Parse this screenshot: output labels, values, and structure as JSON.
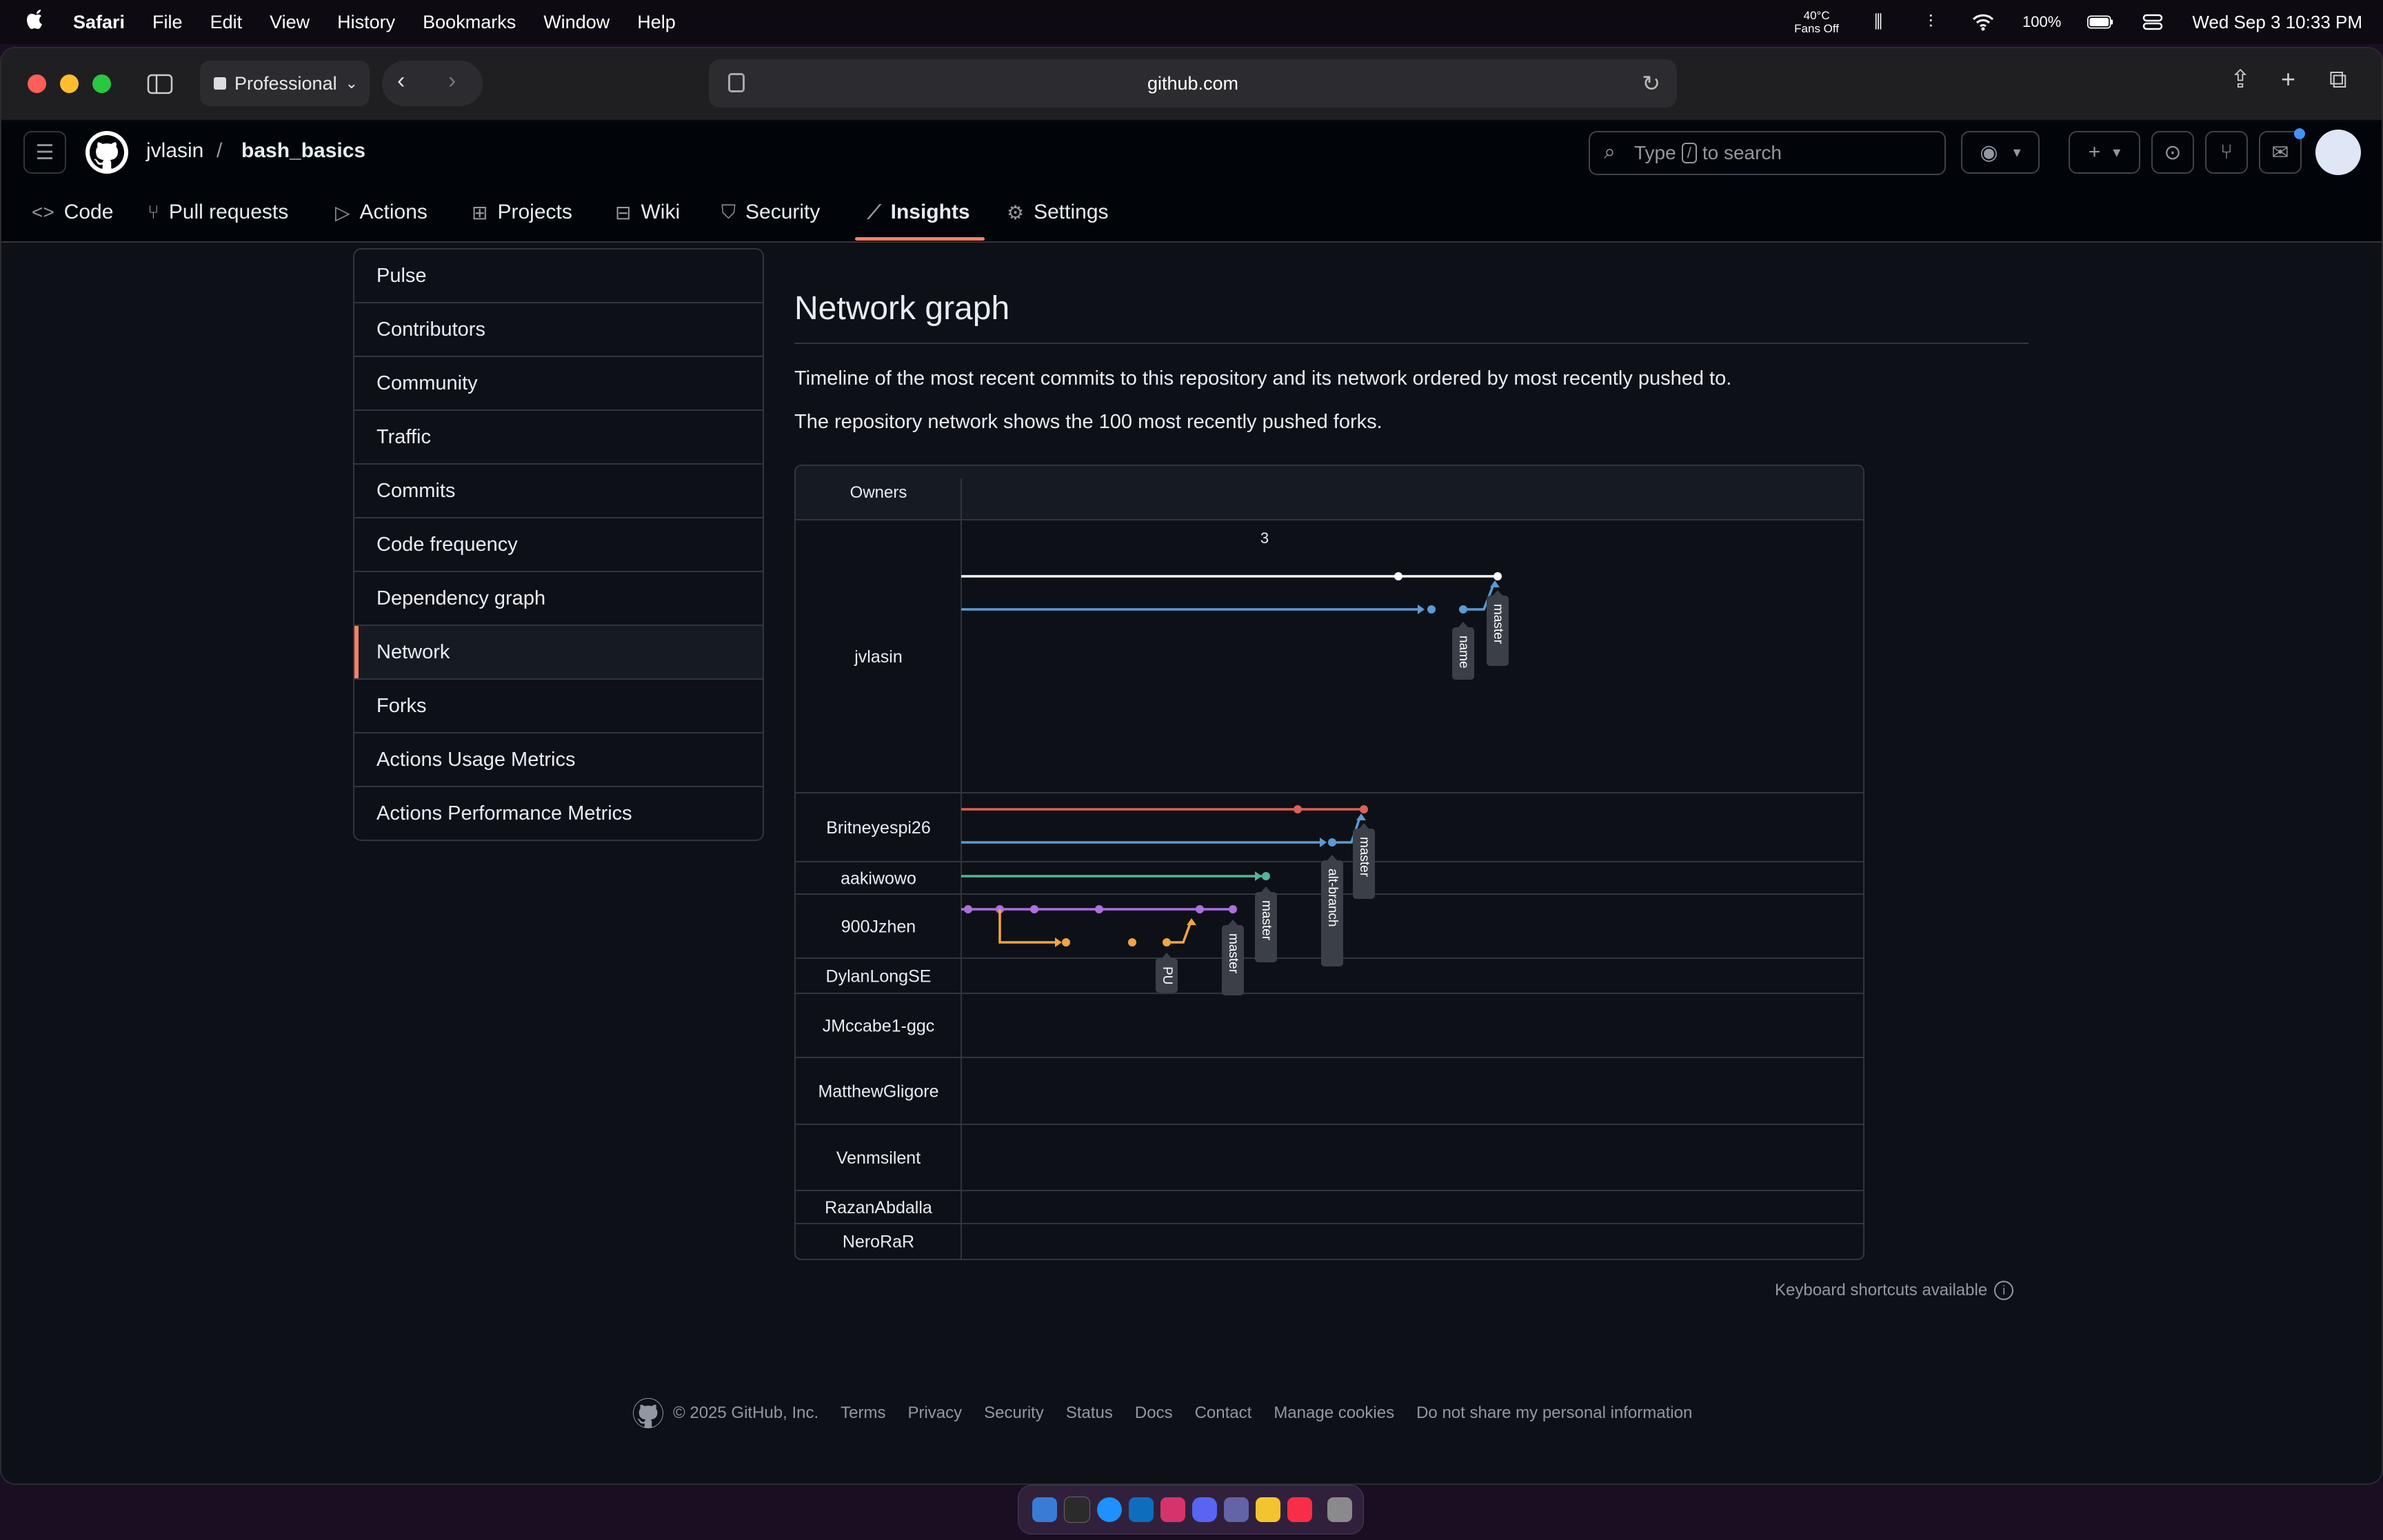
{
  "menubar": {
    "apple": "",
    "app_name": "Safari",
    "items": [
      "File",
      "Edit",
      "View",
      "History",
      "Bookmarks",
      "Window",
      "Help"
    ],
    "temp_line1": "40°C",
    "temp_line2": "Fans Off",
    "battery": "100%",
    "datetime": "Wed Sep 3  10:33 PM"
  },
  "browser": {
    "profile": "Professional",
    "url": "github.com"
  },
  "github": {
    "owner": "jvlasin",
    "separator": "/",
    "repo": "bash_basics",
    "search_pre": "Type",
    "search_key": "/",
    "search_post": "to search",
    "tabs": [
      {
        "label": "Code",
        "icon": "code-icon"
      },
      {
        "label": "Pull requests",
        "icon": "pull-request-icon"
      },
      {
        "label": "Actions",
        "icon": "play-icon"
      },
      {
        "label": "Projects",
        "icon": "table-icon"
      },
      {
        "label": "Wiki",
        "icon": "book-icon"
      },
      {
        "label": "Security",
        "icon": "shield-icon"
      },
      {
        "label": "Insights",
        "icon": "graph-icon"
      },
      {
        "label": "Settings",
        "icon": "gear-icon"
      }
    ],
    "active_tab": "Insights"
  },
  "sidebar": {
    "items": [
      {
        "label": "Pulse"
      },
      {
        "label": "Contributors"
      },
      {
        "label": "Community"
      },
      {
        "label": "Traffic"
      },
      {
        "label": "Commits"
      },
      {
        "label": "Code frequency"
      },
      {
        "label": "Dependency graph"
      },
      {
        "label": "Network"
      },
      {
        "label": "Forks"
      },
      {
        "label": "Actions Usage Metrics"
      },
      {
        "label": "Actions Performance Metrics"
      }
    ],
    "active": "Network"
  },
  "main": {
    "title": "Network graph",
    "description": "Timeline of the most recent commits to this repository and its network ordered by most recently pushed to.",
    "note": "The repository network shows the 100 most recently pushed forks."
  },
  "network": {
    "owners_header": "Owners",
    "date_label": "3",
    "owners": [
      "jvlasin",
      "Britneyespi26",
      "aakiwowo",
      "900Jzhen",
      "DylanLongSE",
      "JMccabe1-ggc",
      "MatthewGligore",
      "Venmsilent",
      "RazanAbdalla",
      "NeroRaR"
    ],
    "branch_labels": [
      "master",
      "name",
      "master",
      "alt-branch",
      "master",
      "master",
      "PU"
    ],
    "colors": {
      "white": "#ffffff",
      "blue": "#5b9bd5",
      "red": "#e06055",
      "green": "#4fb89a",
      "purple": "#b06fe0",
      "orange": "#f2a540"
    }
  },
  "keyboard_hint": "Keyboard shortcuts available",
  "footer": {
    "copyright": "© 2025 GitHub, Inc.",
    "links": [
      "Terms",
      "Privacy",
      "Security",
      "Status",
      "Docs",
      "Contact",
      "Manage cookies",
      "Do not share my personal information"
    ]
  }
}
